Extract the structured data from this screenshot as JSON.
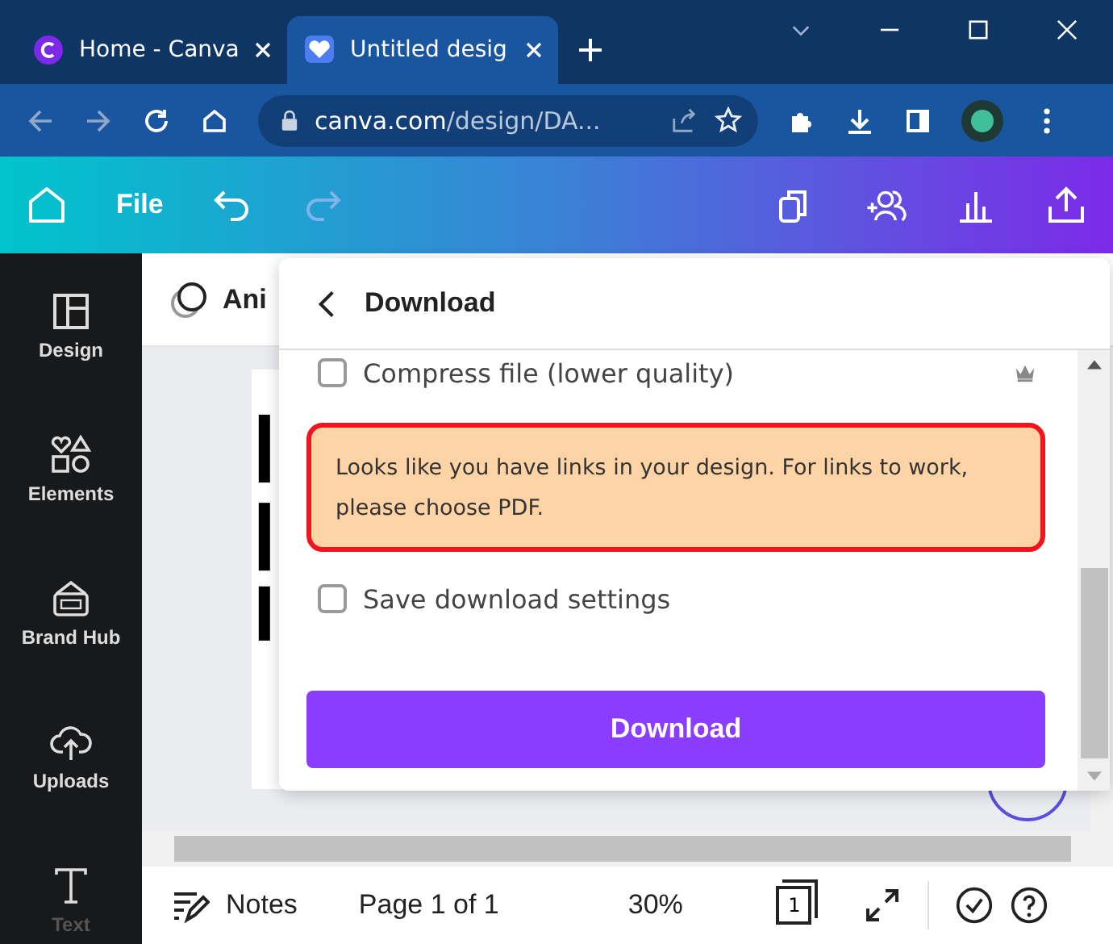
{
  "browser": {
    "tabs": [
      {
        "title": "Home - Canva",
        "selected": false
      },
      {
        "title": "Untitled desig",
        "selected": true
      }
    ],
    "url_host": "canva.com",
    "url_path": "/design/DA..."
  },
  "toolbar": {
    "file_label": "File",
    "redo_disabled": true
  },
  "sidebar": {
    "items": [
      {
        "label": "Design",
        "kind": "design"
      },
      {
        "label": "Elements",
        "kind": "elements"
      },
      {
        "label": "Brand Hub",
        "kind": "brand"
      },
      {
        "label": "Uploads",
        "kind": "uploads"
      },
      {
        "label": "Text",
        "kind": "text"
      }
    ]
  },
  "editor": {
    "header_text": "Ani"
  },
  "dialog": {
    "title": "Download",
    "compress": {
      "label": "Compress file (lower quality)",
      "checked": false
    },
    "warning": "Looks like you have links in your design. For links to work, please choose PDF.",
    "save_settings": {
      "label": "Save download settings",
      "checked": false
    },
    "button": "Download"
  },
  "bottom_bar": {
    "notes": "Notes",
    "page": "Page 1 of 1",
    "zoom": "30%",
    "page_count": "1"
  }
}
